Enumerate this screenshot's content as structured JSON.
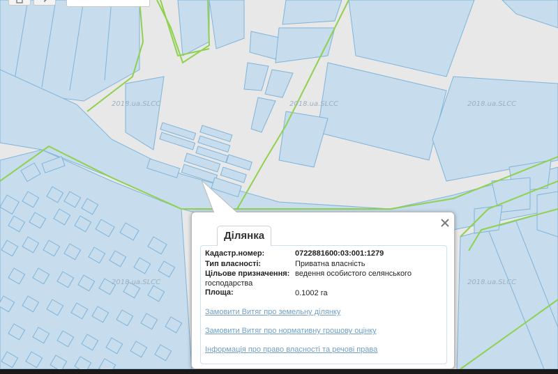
{
  "map": {
    "watermark": "2018.ua.SLCC",
    "colors": {
      "background": "#e8e8e8",
      "parcel_fill": "#c7dcec",
      "parcel_stroke": "#7fb4da",
      "boundary": "#8fd14f",
      "road": "#bcd5ea"
    }
  },
  "toolbar": {
    "icons": [
      "print-icon",
      "help-icon"
    ]
  },
  "popup": {
    "tab_label": "Ділянка",
    "cadastral_label": "Кадастр.номер:",
    "cadastral_value": "0722881600:03:001:1279",
    "ownership_label": "Тип власності:",
    "ownership_value": "Приватна власність",
    "purpose_label": "Цільове призначення:",
    "purpose_value_line1": "ведення особистого селянського",
    "purpose_value_line2": "господарства",
    "area_label": "Площа:",
    "area_value": "0.1002 га",
    "links": [
      "Замовити Витяг про земельну ділянку",
      "Замовити Витяг про нормативну грошову оцінку",
      "Інформація про право власності та речові права"
    ]
  }
}
